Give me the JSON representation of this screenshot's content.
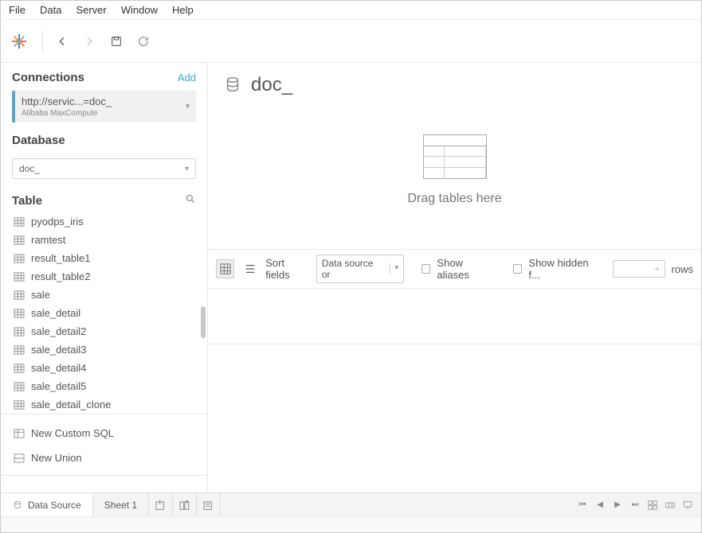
{
  "menu": {
    "file": "File",
    "data": "Data",
    "server": "Server",
    "window": "Window",
    "help": "Help"
  },
  "sidebar": {
    "connections_heading": "Connections",
    "add_label": "Add",
    "connection": {
      "title": "http://servic...=doc_",
      "subtitle": "Alibaba MaxCompute"
    },
    "database_heading": "Database",
    "database_selected": "doc_",
    "table_heading": "Table",
    "tables": [
      "pyodps_iris",
      "ramtest",
      "result_table1",
      "result_table2",
      "sale",
      "sale_detail",
      "sale_detail2",
      "sale_detail3",
      "sale_detail4",
      "sale_detail5",
      "sale_detail_clone"
    ],
    "new_custom_sql": "New Custom SQL",
    "new_union": "New Union"
  },
  "datasource": {
    "title_prefix": "doc_",
    "title_blur": ""
  },
  "dropzone": {
    "text": "Drag tables here"
  },
  "options": {
    "sort_label": "Sort fields",
    "sort_value": "Data source or",
    "show_aliases": "Show aliases",
    "show_hidden": "Show hidden f...",
    "rows_label": "rows"
  },
  "tabs": {
    "data_source": "Data Source",
    "sheet1": "Sheet 1"
  }
}
